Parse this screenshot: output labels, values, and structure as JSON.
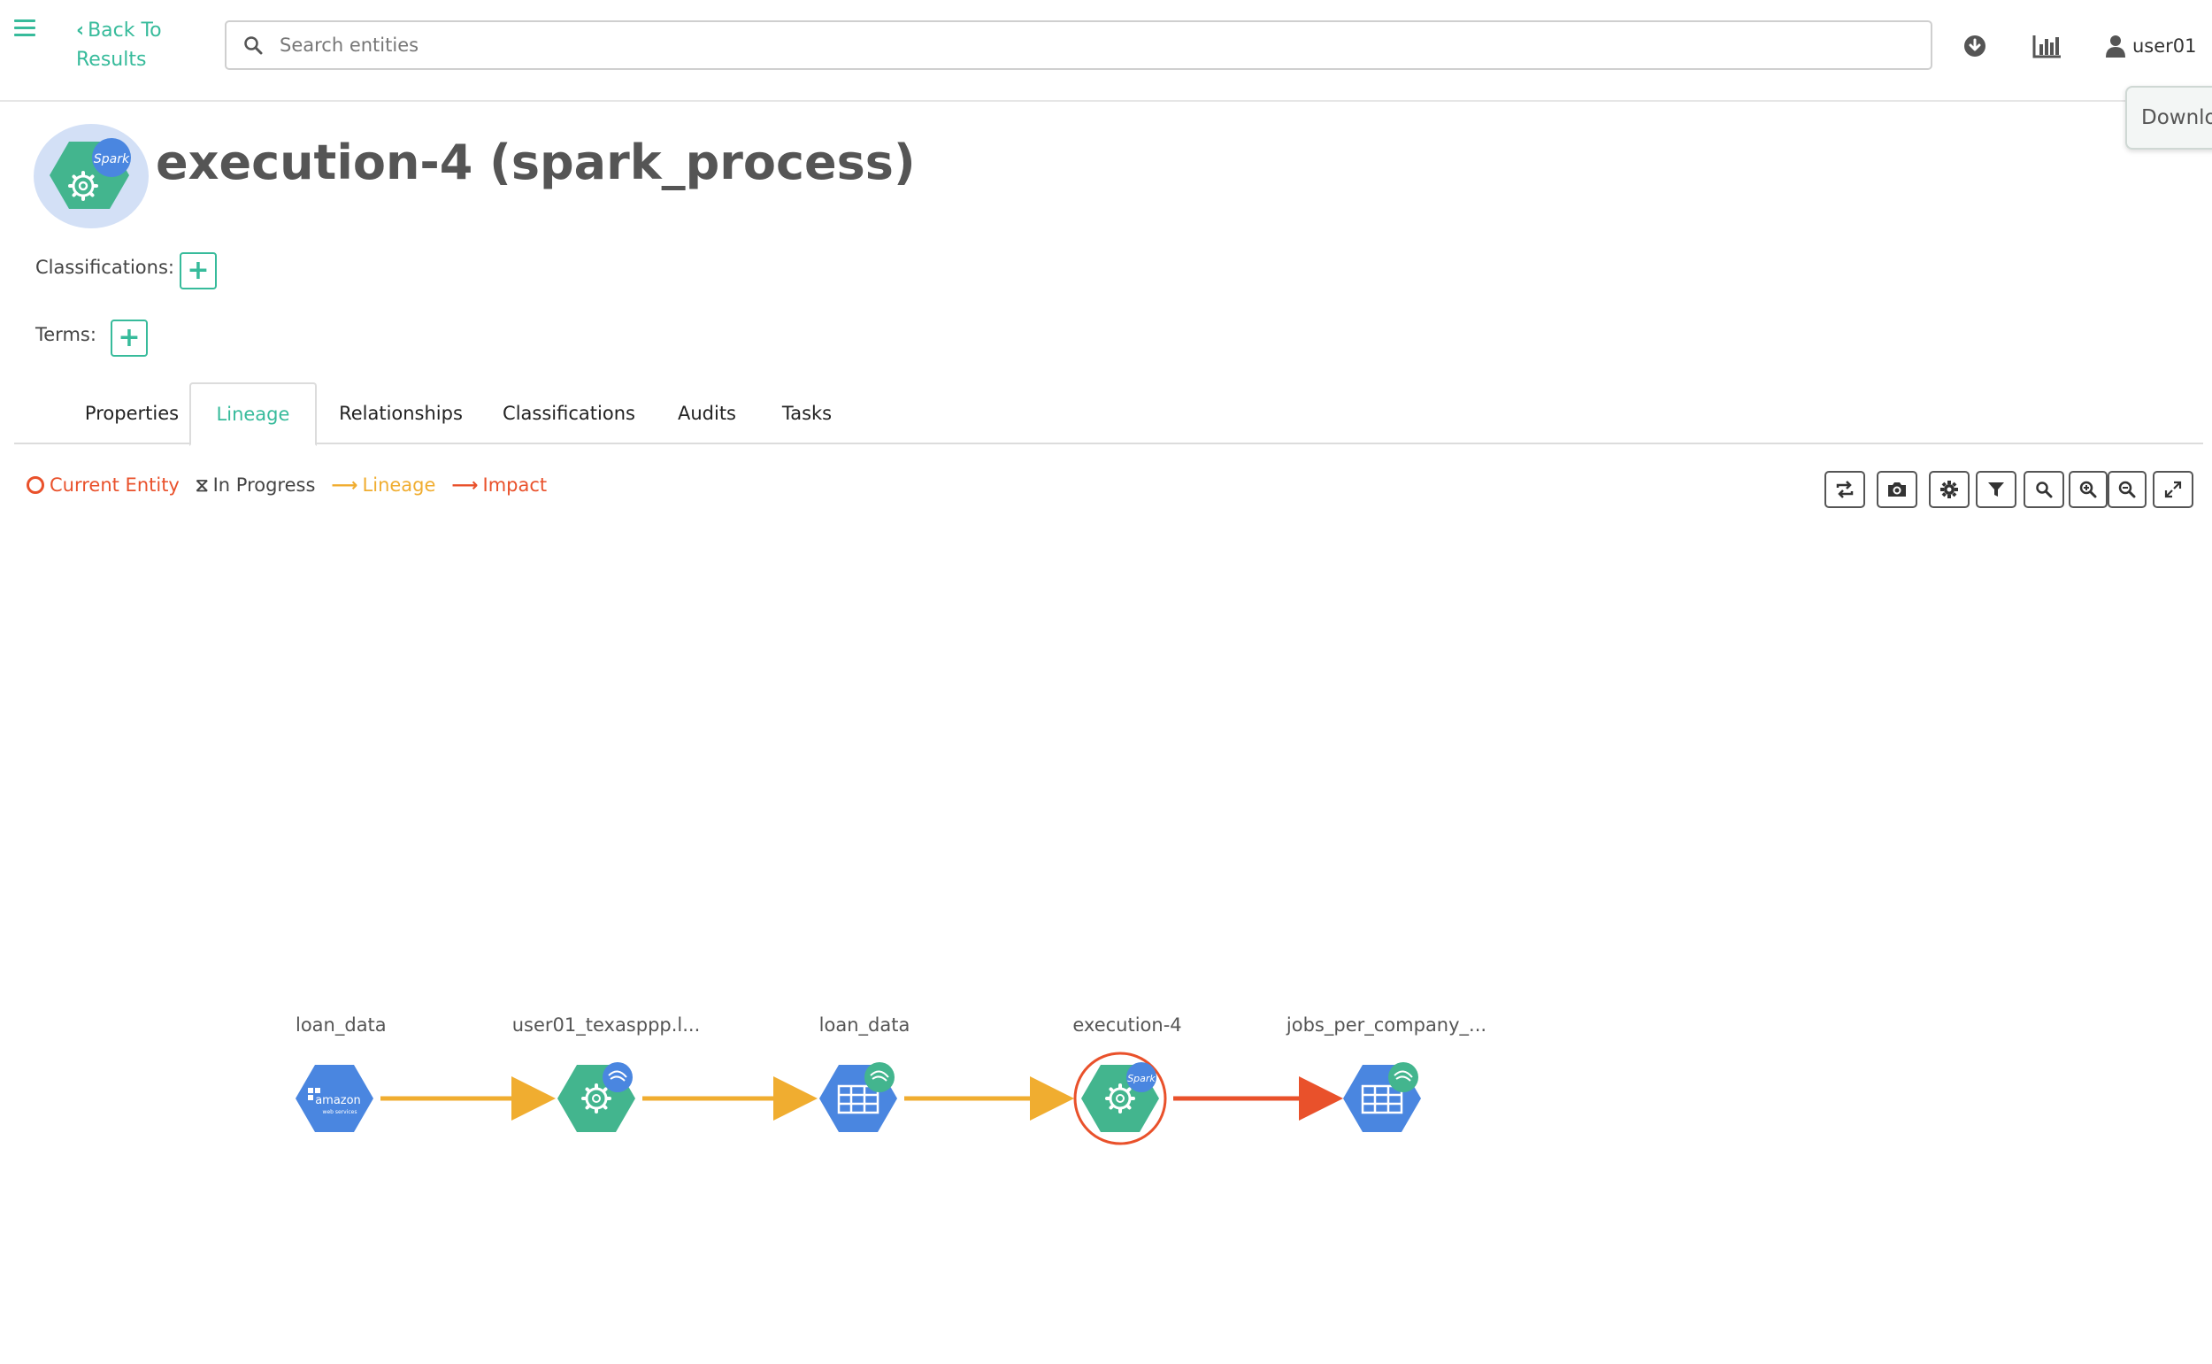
{
  "header": {
    "back_label_line1": "Back To",
    "back_label_line2": "Results",
    "search_placeholder": "Search entities",
    "username": "user01",
    "download_label": "Downlo"
  },
  "entity": {
    "title": "execution-4 (spark_process)",
    "icon": "spark-process-icon",
    "classifications_label": "Classifications:",
    "terms_label": "Terms:"
  },
  "tabs": [
    {
      "label": "Properties"
    },
    {
      "label": "Lineage"
    },
    {
      "label": "Relationships"
    },
    {
      "label": "Classifications"
    },
    {
      "label": "Audits"
    },
    {
      "label": "Tasks"
    }
  ],
  "legend": {
    "current": "Current Entity",
    "progress": "In Progress",
    "lineage": "Lineage",
    "impact": "Impact"
  },
  "colors": {
    "accent": "#37bb9b",
    "lineage": "#f0ad30",
    "impact": "#e9512b",
    "node_blue": "#4a86e0",
    "node_green": "#43b58e"
  },
  "toolbar": [
    "refresh-icon",
    "camera-icon",
    "settings-icon",
    "filter-icon",
    "search-icon",
    "zoom-in-icon",
    "zoom-out-icon",
    "fullscreen-icon"
  ],
  "nodes": [
    {
      "label": "loan_data",
      "type": "aws",
      "icon": "amazon-webservices-icon"
    },
    {
      "label": "user01_texasppp.l...",
      "type": "process",
      "icon": "gear-icon"
    },
    {
      "label": "loan_data",
      "type": "table",
      "icon": "table-icon"
    },
    {
      "label": "execution-4",
      "type": "spark",
      "icon": "gear-icon"
    },
    {
      "label": "jobs_per_company_...",
      "type": "table",
      "icon": "table-icon"
    }
  ],
  "node_badges": {
    "aws_text": "amazon",
    "aws_subtext": "web services",
    "spark_text": "Spark"
  }
}
